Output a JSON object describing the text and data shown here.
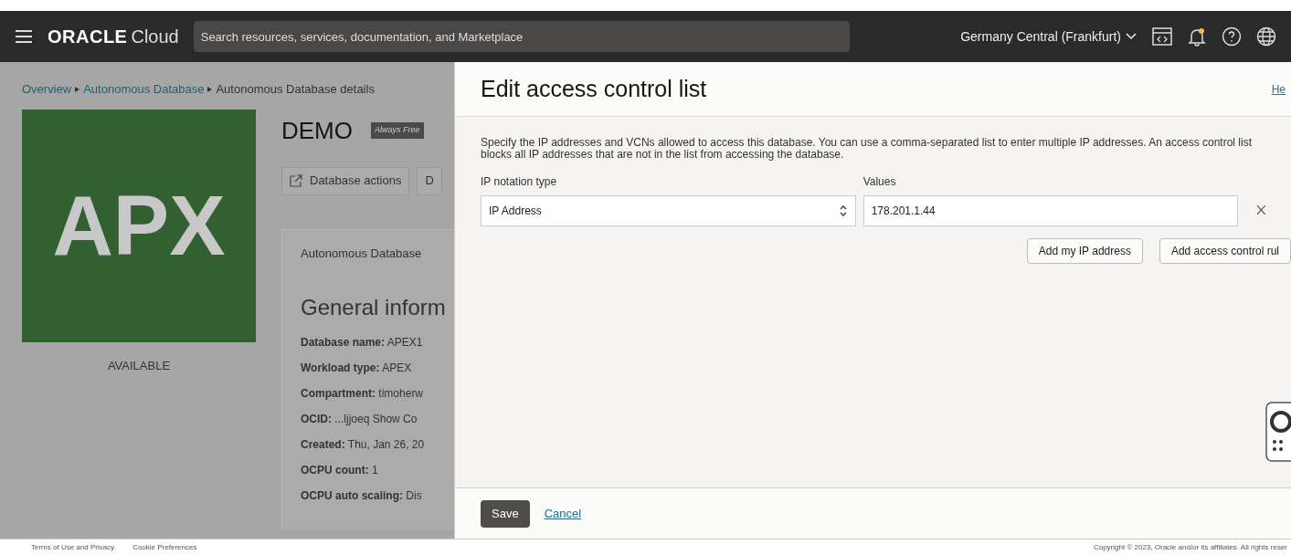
{
  "header": {
    "brand": "ORACLE",
    "product": "Cloud",
    "search": {
      "placeholder": "Search resources, services, documentation, and Marketplace"
    },
    "region": "Germany Central (Frankfurt)",
    "notification_dot": true
  },
  "breadcrumb": [
    {
      "label": "Overview",
      "link": true
    },
    {
      "label": "Autonomous Database",
      "link": true
    },
    {
      "label": "Autonomous Database details",
      "link": false
    }
  ],
  "database": {
    "tile": "APX",
    "status": "AVAILABLE",
    "name": "DEMO",
    "badge": "Always Free",
    "actions": [
      "Database actions",
      "D"
    ],
    "card_tab": "Autonomous Database",
    "section": "General inform",
    "fields": [
      {
        "label": "Database name:",
        "value": "APEX1"
      },
      {
        "label": "Workload type:",
        "value": "APEX"
      },
      {
        "label": "Compartment:",
        "value": "timoherw"
      },
      {
        "label": "OCID:",
        "value": "...ljjoeq  Show  Co"
      },
      {
        "label": "Created:",
        "value": "Thu, Jan 26, 20"
      },
      {
        "label": "OCPU count:",
        "value": "1"
      },
      {
        "label": "OCPU auto scaling:",
        "value": "Dis"
      }
    ]
  },
  "panel": {
    "title": "Edit access control list",
    "help": "He",
    "description": "Specify the IP addresses and VCNs allowed to access this database. You can use a comma-separated list to enter multiple IP addresses. An access control list blocks all IP addresses that are not in the list from accessing the database.",
    "rules": [
      {
        "notation_label": "IP notation type",
        "notation": "IP Address",
        "values_label": "Values",
        "value": "178.201.1.44"
      }
    ],
    "buttons": [
      "Add my IP address",
      "Add access control rul"
    ],
    "save": "Save",
    "cancel": "Cancel"
  },
  "footer": {
    "links": [
      "Terms of Use and Privacy",
      "Cookie Preferences"
    ],
    "copyright": "Copyright © 2023, Oracle and/or its affiliates. All rights reser"
  }
}
